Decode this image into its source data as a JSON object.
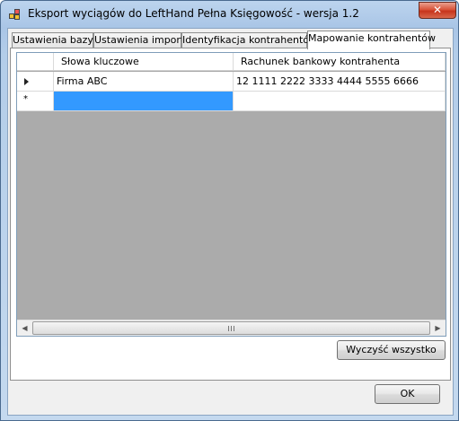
{
  "window": {
    "title": "Eksport wyciągów do LeftHand Pełna Księgowość - wersja 1.2",
    "close_glyph": "✕",
    "icon": "app-icon"
  },
  "tabs": [
    {
      "label": "Ustawienia bazy",
      "active": false
    },
    {
      "label": "Ustawienia importu",
      "active": false
    },
    {
      "label": "Identyfikacja kontrahentów",
      "active": false
    },
    {
      "label": "Mapowanie kontrahentów",
      "active": true
    }
  ],
  "grid": {
    "columns": [
      "Słowa kluczowe",
      "Rachunek bankowy kontrahenta"
    ],
    "rows": [
      {
        "marker": "current-row-arrow",
        "keywords": "Firma ABC",
        "account": "12 1111 2222 3333 4444 5555 6666"
      },
      {
        "marker": "*",
        "keywords": "",
        "account": ""
      }
    ],
    "scroll": {
      "left_glyph": "◀",
      "right_glyph": "▶"
    }
  },
  "buttons": {
    "clear_all": "Wyczyść wszystko",
    "ok": "OK"
  }
}
